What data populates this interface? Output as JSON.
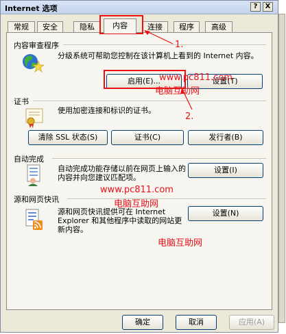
{
  "window": {
    "title": "Internet 选项",
    "help_btn": "?",
    "close_btn": "X"
  },
  "tabs": [
    "常规",
    "安全",
    "隐私",
    "内容",
    "连接",
    "程序",
    "高级"
  ],
  "active_tab": "内容",
  "sections": {
    "content_advisor": {
      "label": "内容审查程序",
      "description": "分级系统可帮助您控制在该计算机上看到的 Internet 内容。",
      "enable_button": "启用(E)...",
      "settings_button": "设置(T)"
    },
    "certificates": {
      "label": "证书",
      "description": "使用加密连接和标识的证书。",
      "clear_ssl_button": "清除 SSL 状态(S)",
      "certificates_button": "证书(C)",
      "publishers_button": "发行者(B)"
    },
    "autocomplete": {
      "label": "自动完成",
      "description": "自动完成功能存储以前在网页上输入的内容并向您建议匹配项。",
      "settings_button": "设置(I)"
    },
    "feeds": {
      "label": "源和网页快讯",
      "description": "源和网页快讯提供可在 Internet Explorer 和其他程序中读取的网站更新内容。",
      "settings_button": "设置(N)"
    }
  },
  "footer": {
    "ok_button": "确定",
    "cancel_button": "取消",
    "apply_button": "应用(A)"
  },
  "annotations": {
    "watermark_url": "www.pc811.com",
    "watermark_name": "电脑互助网",
    "step1": "1.",
    "step2": "2.",
    "color": "#ee1010"
  },
  "icons": {
    "content_advisor": "globe-star-icon",
    "certificates": "certificate-icon",
    "autocomplete": "autocomplete-form-icon",
    "feeds": "rss-feed-icon"
  }
}
